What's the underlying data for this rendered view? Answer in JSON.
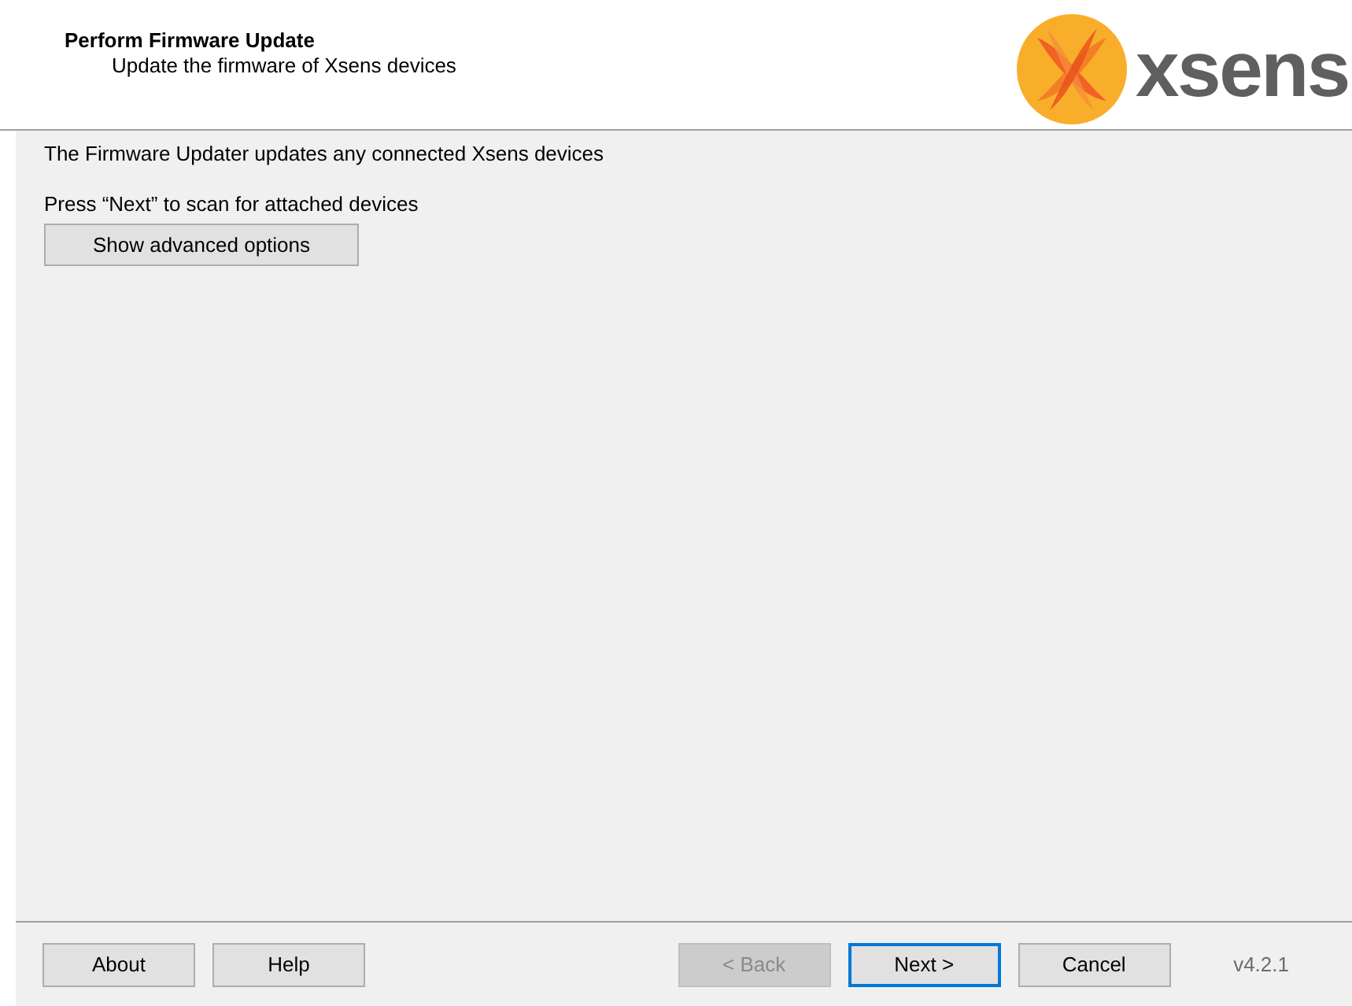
{
  "header": {
    "title": "Perform Firmware Update",
    "subtitle": "Update the firmware of Xsens devices",
    "logo_text": "xsens"
  },
  "body": {
    "lines": [
      "The Firmware Updater updates any connected Xsens devices",
      "Press “Next” to scan for attached devices"
    ],
    "advanced_button": "Show advanced options"
  },
  "footer": {
    "left_buttons": [
      {
        "label": "About",
        "disabled": false,
        "default": false
      },
      {
        "label": "Help",
        "disabled": false,
        "default": false
      }
    ],
    "right_buttons": [
      {
        "label": "< Back",
        "disabled": true,
        "default": false
      },
      {
        "label": "Next >",
        "disabled": false,
        "default": true
      },
      {
        "label": "Cancel",
        "disabled": false,
        "default": false
      }
    ],
    "version": "v4.2.1"
  }
}
